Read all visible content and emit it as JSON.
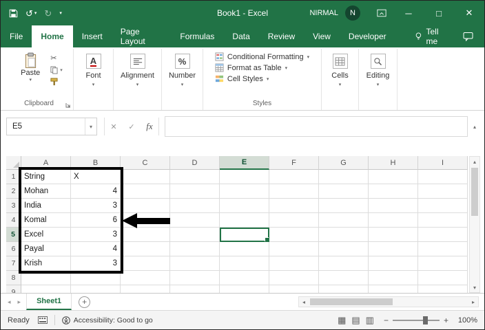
{
  "window": {
    "title": "Book1 - Excel",
    "user_name": "NIRMAL",
    "avatar_initial": "N"
  },
  "tabs": {
    "items": [
      "File",
      "Home",
      "Insert",
      "Page Layout",
      "Formulas",
      "Data",
      "Review",
      "View",
      "Developer"
    ],
    "active": "Home",
    "tell_me": "Tell me"
  },
  "ribbon": {
    "paste_label": "Paste",
    "clipboard_group": "Clipboard",
    "font_group": "Font",
    "alignment_group": "Alignment",
    "number_group": "Number",
    "styles_group": "Styles",
    "cells_group": "Cells",
    "editing_group": "Editing",
    "conditional_formatting": "Conditional Formatting",
    "format_as_table": "Format as Table",
    "cell_styles": "Cell Styles",
    "font_icon_letter": "A",
    "number_icon": "%"
  },
  "formula_bar": {
    "name_box": "E5",
    "fx_label": "fx",
    "value": ""
  },
  "sheet": {
    "columns": [
      "A",
      "B",
      "C",
      "D",
      "E",
      "F",
      "G",
      "H",
      "I"
    ],
    "rows": [
      1,
      2,
      3,
      4,
      5,
      6,
      7,
      8,
      9
    ],
    "selected_column": "E",
    "selected_row": 5,
    "selected_cell": "E5",
    "data": [
      [
        "String",
        "X"
      ],
      [
        "Mohan",
        "4"
      ],
      [
        "India",
        "3"
      ],
      [
        "Komal",
        "6"
      ],
      [
        "Excel",
        "3"
      ],
      [
        "Payal",
        "4"
      ],
      [
        "Krish",
        "3"
      ]
    ]
  },
  "sheet_tabs": {
    "active": "Sheet1"
  },
  "status_bar": {
    "mode": "Ready",
    "accessibility": "Accessibility: Good to go",
    "zoom": "100%"
  },
  "colors": {
    "excel_green": "#217346",
    "annotation_black": "#000000"
  },
  "icons": {
    "undo": "↺",
    "redo": "↻",
    "qat_caret": "▾",
    "minimize": "─",
    "maximize": "□",
    "close": "✕",
    "cut": "✂",
    "dropdown": "▾",
    "cancel": "✕",
    "enter": "✓",
    "scroll_up": "▴",
    "scroll_down": "▾",
    "scroll_left": "◂",
    "scroll_right": "▸",
    "add_sheet": "+",
    "view_normal": "▦",
    "view_layout": "▤",
    "view_break": "▥",
    "zoom_out": "−",
    "zoom_in": "+",
    "expand_formula": "▴"
  }
}
